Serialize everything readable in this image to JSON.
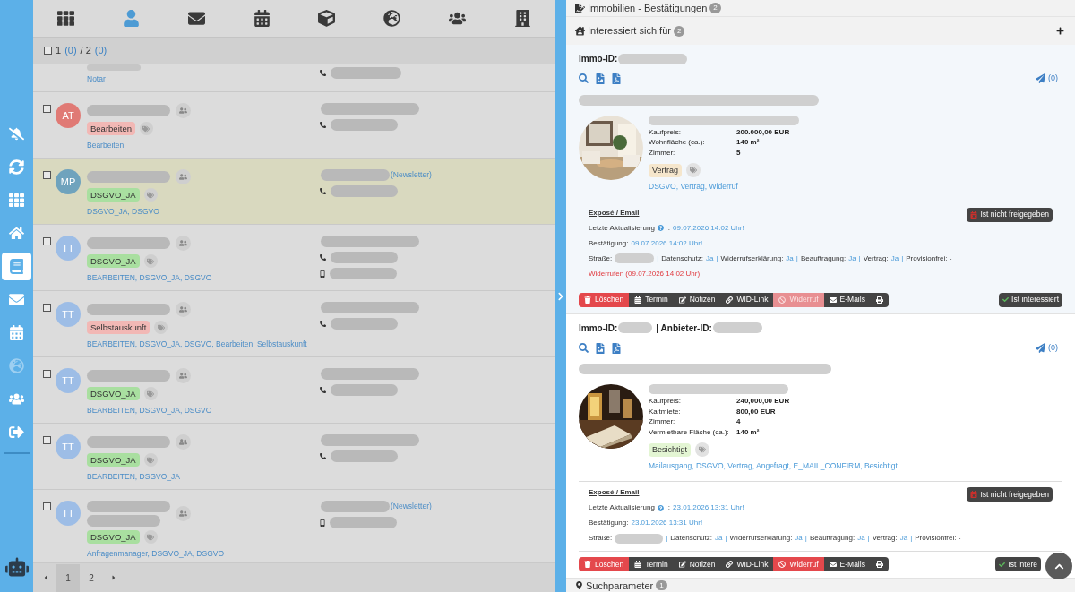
{
  "sidebar": {
    "items": [
      {
        "kind": "bell-off",
        "selected": false,
        "disabled": false
      },
      {
        "kind": "sync",
        "selected": false,
        "disabled": false
      },
      {
        "kind": "grid",
        "selected": false,
        "disabled": false
      },
      {
        "kind": "home",
        "selected": false,
        "disabled": false
      },
      {
        "kind": "book",
        "selected": true,
        "disabled": false
      },
      {
        "kind": "mail",
        "selected": false,
        "disabled": false
      },
      {
        "kind": "calendar",
        "selected": false,
        "disabled": false
      },
      {
        "kind": "globe",
        "selected": false,
        "disabled": true
      },
      {
        "kind": "users",
        "selected": false,
        "disabled": false
      },
      {
        "kind": "logout",
        "selected": false,
        "disabled": false
      }
    ]
  },
  "toolbar": {
    "items": [
      {
        "kind": "grid",
        "selected": false
      },
      {
        "kind": "user",
        "selected": true
      },
      {
        "kind": "mail",
        "selected": false
      },
      {
        "kind": "calendar",
        "selected": false
      },
      {
        "kind": "cube",
        "selected": false
      },
      {
        "kind": "globe",
        "selected": false
      },
      {
        "kind": "users",
        "selected": false
      },
      {
        "kind": "building",
        "selected": false
      }
    ]
  },
  "selection": {
    "checked": false,
    "count": "1",
    "count_marked": "(0)",
    "separator": "/ 2",
    "total_marked": "(0)"
  },
  "partial_row": {
    "tags": "Notar"
  },
  "contacts": [
    {
      "kind": "single",
      "initials": "AT",
      "color": "#e07a75",
      "selected": false,
      "checked": false,
      "tag": {
        "label": "Bearbeiten",
        "color": "#f2b8b5"
      },
      "tags": "Bearbeiten",
      "phones": [
        {
          "kind": "phone"
        }
      ]
    },
    {
      "kind": "single",
      "initials": "MP",
      "color": "#6fa3bd",
      "selected": true,
      "checked": false,
      "tag": {
        "label": "DSGVO_JA",
        "color": "#a9dfa0"
      },
      "tags": "DSGVO_JA, DSGVO",
      "newsletter": "(Newsletter)",
      "phones": [
        {
          "kind": "phone"
        }
      ]
    },
    {
      "kind": "single",
      "initials": "TT",
      "color": "#9dbde6",
      "selected": false,
      "checked": false,
      "tag": {
        "label": "DSGVO_JA",
        "color": "#a9dfa0"
      },
      "tags": "BEARBEITEN, DSGVO_JA, DSGVO",
      "phones": [
        {
          "kind": "phone"
        },
        {
          "kind": "mobile"
        }
      ]
    },
    {
      "kind": "single",
      "initials": "TT",
      "color": "#9dbde6",
      "selected": false,
      "checked": false,
      "tag": {
        "label": "Selbstauskunft",
        "color": "#f2b8b5"
      },
      "tags": "BEARBEITEN, DSGVO_JA, DSGVO, Bearbeiten, Selbstauskunft",
      "phones": [
        {
          "kind": "phone"
        }
      ]
    },
    {
      "kind": "single",
      "initials": "TT",
      "color": "#9dbde6",
      "selected": false,
      "checked": false,
      "tag": {
        "label": "DSGVO_JA",
        "color": "#a9dfa0"
      },
      "tags": "BEARBEITEN, DSGVO_JA, DSGVO",
      "phones": [
        {
          "kind": "phone"
        }
      ]
    },
    {
      "kind": "single",
      "initials": "TT",
      "color": "#9dbde6",
      "selected": false,
      "checked": false,
      "tag": {
        "label": "DSGVO_JA",
        "color": "#a9dfa0"
      },
      "tags": "BEARBEITEN, DSGVO_JA",
      "phones": [
        {
          "kind": "phone"
        }
      ]
    },
    {
      "kind": "double",
      "initials": "TT",
      "color": "#9dbde6",
      "selected": false,
      "checked": false,
      "tag": {
        "label": "DSGVO_JA",
        "color": "#a9dfa0"
      },
      "tags": "Anfragenmanager, DSGVO_JA, DSGVO",
      "newsletter": "(Newsletter)",
      "phones": [
        {
          "kind": "mobile"
        }
      ]
    }
  ],
  "pagination": {
    "pages": [
      {
        "label": "1",
        "selected": true
      },
      {
        "label": "2",
        "selected": false
      }
    ]
  },
  "panel": {
    "title": "Immobilien - Bestätigungen",
    "title_count": "2",
    "section": "Interessiert sich für",
    "section_count": "2",
    "properties": [
      {
        "kind": "sale",
        "id_label": "Immo-ID:",
        "send_count": "(0)",
        "facts": [
          {
            "label": "Kaufpreis:",
            "value": "200.000,00 EUR"
          },
          {
            "label": "Wohnfläche (ca.):",
            "value": "140 m²"
          },
          {
            "label": "Zimmer:",
            "value": "5"
          }
        ],
        "status": {
          "label": "Vertrag",
          "color": "#f5e6cc"
        },
        "tags": "DSGVO, Vertrag, Widerruf",
        "expose": {
          "title": "Exposé / Email",
          "updated_label": "Letzte Aktualisierung",
          "colon": ":",
          "separator": "|",
          "updated": "09.07.2026 14:02 Uhr!",
          "confirm_label": "Bestätigung:",
          "confirmed": "09.07.2026 14:02 Uhr!",
          "street_label": "Straße:",
          "fields": [
            {
              "label": "Datenschutz:",
              "value": "Ja"
            },
            {
              "label": "Widerrufserklärung:",
              "value": "Ja"
            },
            {
              "label": "Beauftragung:",
              "value": "Ja"
            },
            {
              "label": "Vertrag:",
              "value": "Ja"
            }
          ],
          "provision": "Provisionfrei: -",
          "revoked": "Widerrufen (09.07.2026 14:02 Uhr)",
          "release": "Ist nicht freigegeben"
        },
        "actions": [
          {
            "kind": "delete",
            "label": "Löschen",
            "disabled": false
          },
          {
            "kind": "appointment",
            "label": "Termin",
            "disabled": false
          },
          {
            "kind": "notes",
            "label": "Notizen",
            "disabled": false
          },
          {
            "kind": "link",
            "label": "WID-Link",
            "disabled": false
          },
          {
            "kind": "revoke",
            "label": "Widerruf",
            "disabled": true
          },
          {
            "kind": "mail",
            "label": "E-Mails",
            "disabled": false
          },
          {
            "kind": "print",
            "disabled": false
          }
        ],
        "interest": "Ist interessiert"
      },
      {
        "kind": "rent",
        "id_label": "Immo-ID:",
        "provider_label": "| Anbieter-ID:",
        "send_count": "(0)",
        "facts": [
          {
            "label": "Kaufpreis:",
            "value": "240,000,00 EUR"
          },
          {
            "label": "Kaltmiete:",
            "value": "800,00 EUR"
          },
          {
            "label": "Zimmer:",
            "value": "4"
          },
          {
            "label": "Vermietbare Fläche (ca.):",
            "value": "140 m²"
          }
        ],
        "status": {
          "label": "Besichtigt",
          "color": "#e3f5d3"
        },
        "tags": "Mailausgang, DSGVO, Vertrag, Angefragt, E_MAIL_CONFIRM, Besichtigt",
        "expose": {
          "title": "Exposé / Email",
          "updated_label": "Letzte Aktualisierung",
          "colon": ":",
          "separator": "|",
          "updated": "23.01.2026 13:31 Uhr!",
          "confirm_label": "Bestätigung:",
          "confirmed": "23.01.2026 13:31 Uhr!",
          "street_label": "Straße:",
          "fields": [
            {
              "label": "Datenschutz:",
              "value": "Ja"
            },
            {
              "label": "Widerrufserklärung:",
              "value": "Ja"
            },
            {
              "label": "Beauftragung:",
              "value": "Ja"
            },
            {
              "label": "Vertrag:",
              "value": "Ja"
            }
          ],
          "provision": "Provisionfrei: -",
          "release": "Ist nicht freigegeben"
        },
        "actions": [
          {
            "kind": "delete",
            "label": "Löschen",
            "disabled": false
          },
          {
            "kind": "appointment",
            "label": "Termin",
            "disabled": false
          },
          {
            "kind": "notes",
            "label": "Notizen",
            "disabled": false
          },
          {
            "kind": "link",
            "label": "WID-Link",
            "disabled": false
          },
          {
            "kind": "revoke",
            "label": "Widerruf",
            "disabled": false
          },
          {
            "kind": "mail",
            "label": "E-Mails",
            "disabled": false
          },
          {
            "kind": "print",
            "disabled": false
          }
        ],
        "interest": "Ist intere"
      }
    ],
    "footer": {
      "label": "Suchparameter",
      "count": "1"
    }
  }
}
